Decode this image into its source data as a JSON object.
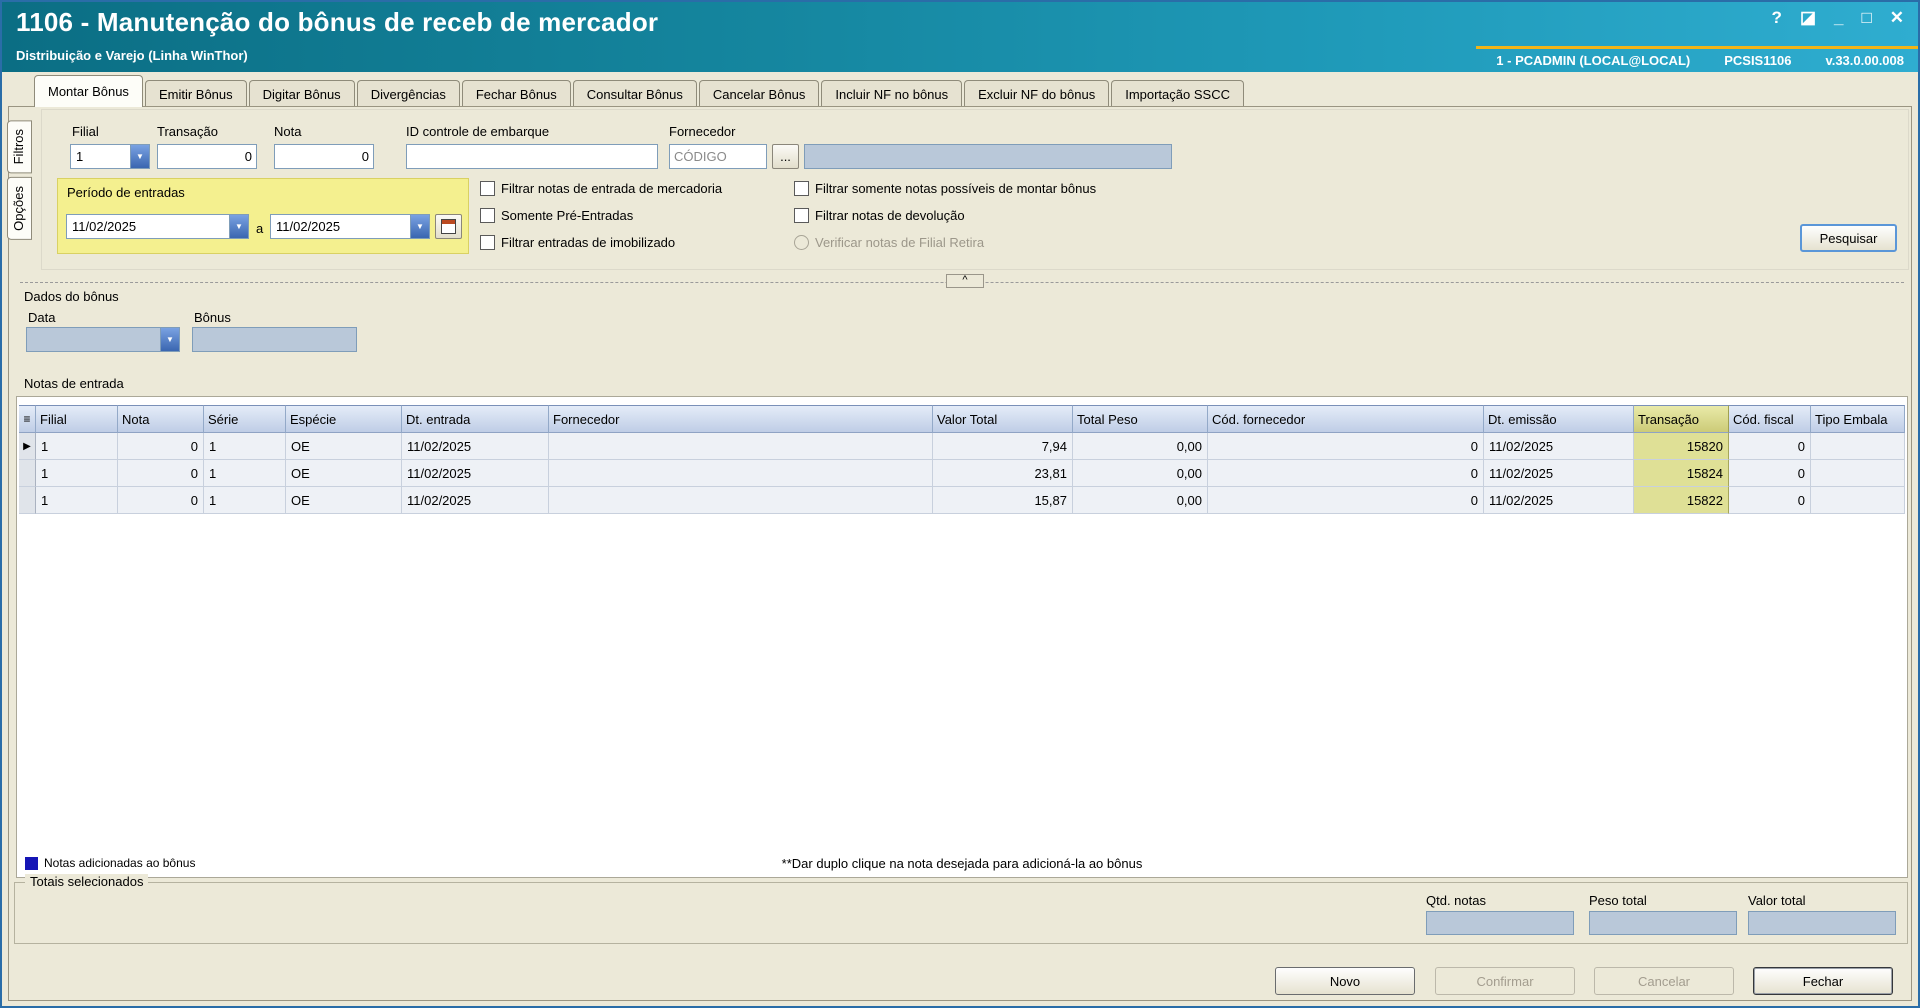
{
  "window": {
    "title": "1106 - Manutenção do bônus de receb de mercador",
    "subtitle": "Distribuição e Varejo (Linha WinThor)",
    "user_info": "1 - PCADMIN (LOCAL@LOCAL)",
    "system_code": "PCSIS1106",
    "version": "v.33.0.00.008",
    "controls": {
      "help": "?",
      "screen": "◪",
      "minimize": "_",
      "maximize": "□",
      "close": "✕"
    }
  },
  "tabs": [
    {
      "label": "Montar Bônus"
    },
    {
      "label": "Emitir Bônus"
    },
    {
      "label": "Digitar Bônus"
    },
    {
      "label": "Divergências"
    },
    {
      "label": "Fechar Bônus"
    },
    {
      "label": "Consultar Bônus"
    },
    {
      "label": "Cancelar Bônus"
    },
    {
      "label": "Incluir NF no bônus"
    },
    {
      "label": "Excluir NF do bônus"
    },
    {
      "label": "Importação SSCC"
    }
  ],
  "side_tabs": {
    "filtros": "Filtros",
    "opcoes": "Opções"
  },
  "filters": {
    "filial": {
      "label": "Filial",
      "value": "1"
    },
    "transacao": {
      "label": "Transação",
      "value": "0"
    },
    "nota": {
      "label": "Nota",
      "value": "0"
    },
    "id_embarque": {
      "label": "ID controle de embarque",
      "value": ""
    },
    "fornecedor": {
      "label": "Fornecedor",
      "placeholder": "CÓDIGO",
      "browse": "...",
      "name_value": ""
    },
    "periodo": {
      "label": "Período de entradas",
      "from": "11/02/2025",
      "separator": "a",
      "to": "11/02/2025"
    },
    "checks_col1": [
      {
        "label": "Filtrar notas de entrada de mercadoria"
      },
      {
        "label": "Somente Pré-Entradas"
      },
      {
        "label": "Filtrar entradas de imobilizado"
      }
    ],
    "checks_col2": [
      {
        "label": "Filtrar somente notas possíveis de montar bônus"
      },
      {
        "label": "Filtrar notas de devolução"
      },
      {
        "label": "Verificar notas de Filial Retira"
      }
    ],
    "search": "Pesquisar"
  },
  "collapse": "^",
  "bonus": {
    "title": "Dados do bônus",
    "data_label": "Data",
    "bonus_label": "Bônus"
  },
  "notas": {
    "title": "Notas de entrada",
    "header_icon": "≡",
    "row_marker": "▶",
    "columns": [
      "Filial",
      "Nota",
      "Série",
      "Espécie",
      "Dt. entrada",
      "Fornecedor",
      "Valor Total",
      "Total Peso",
      "Cód. fornecedor",
      "Dt. emissão",
      "Transação",
      "Cód. fiscal",
      "Tipo Embala"
    ],
    "rows": [
      {
        "filial": "1",
        "nota": "0",
        "serie": "1",
        "especie": "OE",
        "dt_entrada": "11/02/2025",
        "fornecedor": "",
        "valor_total": "7,94",
        "total_peso": "0,00",
        "cod_fornecedor": "0",
        "dt_emissao": "11/02/2025",
        "transacao": "15820",
        "cod_fiscal": "0",
        "tipo_embala": ""
      },
      {
        "filial": "1",
        "nota": "0",
        "serie": "1",
        "especie": "OE",
        "dt_entrada": "11/02/2025",
        "fornecedor": "",
        "valor_total": "23,81",
        "total_peso": "0,00",
        "cod_fornecedor": "0",
        "dt_emissao": "11/02/2025",
        "transacao": "15824",
        "cod_fiscal": "0",
        "tipo_embala": ""
      },
      {
        "filial": "1",
        "nota": "0",
        "serie": "1",
        "especie": "OE",
        "dt_entrada": "11/02/2025",
        "fornecedor": "",
        "valor_total": "15,87",
        "total_peso": "0,00",
        "cod_fornecedor": "0",
        "dt_emissao": "11/02/2025",
        "transacao": "15822",
        "cod_fiscal": "0",
        "tipo_embala": ""
      }
    ],
    "legend": "Notas adicionadas ao bônus",
    "hint": "**Dar duplo clique na nota desejada para adicioná-la ao bônus"
  },
  "totais": {
    "title": "Totais selecionados",
    "qtd_label": "Qtd. notas",
    "peso_label": "Peso total",
    "valor_label": "Valor total",
    "qtd_value": "",
    "peso_value": "",
    "valor_value": ""
  },
  "footer": {
    "novo": "Novo",
    "confirmar": "Confirmar",
    "cancelar": "Cancelar",
    "fechar": "Fechar"
  },
  "icons": {
    "dropdown": "▼"
  }
}
